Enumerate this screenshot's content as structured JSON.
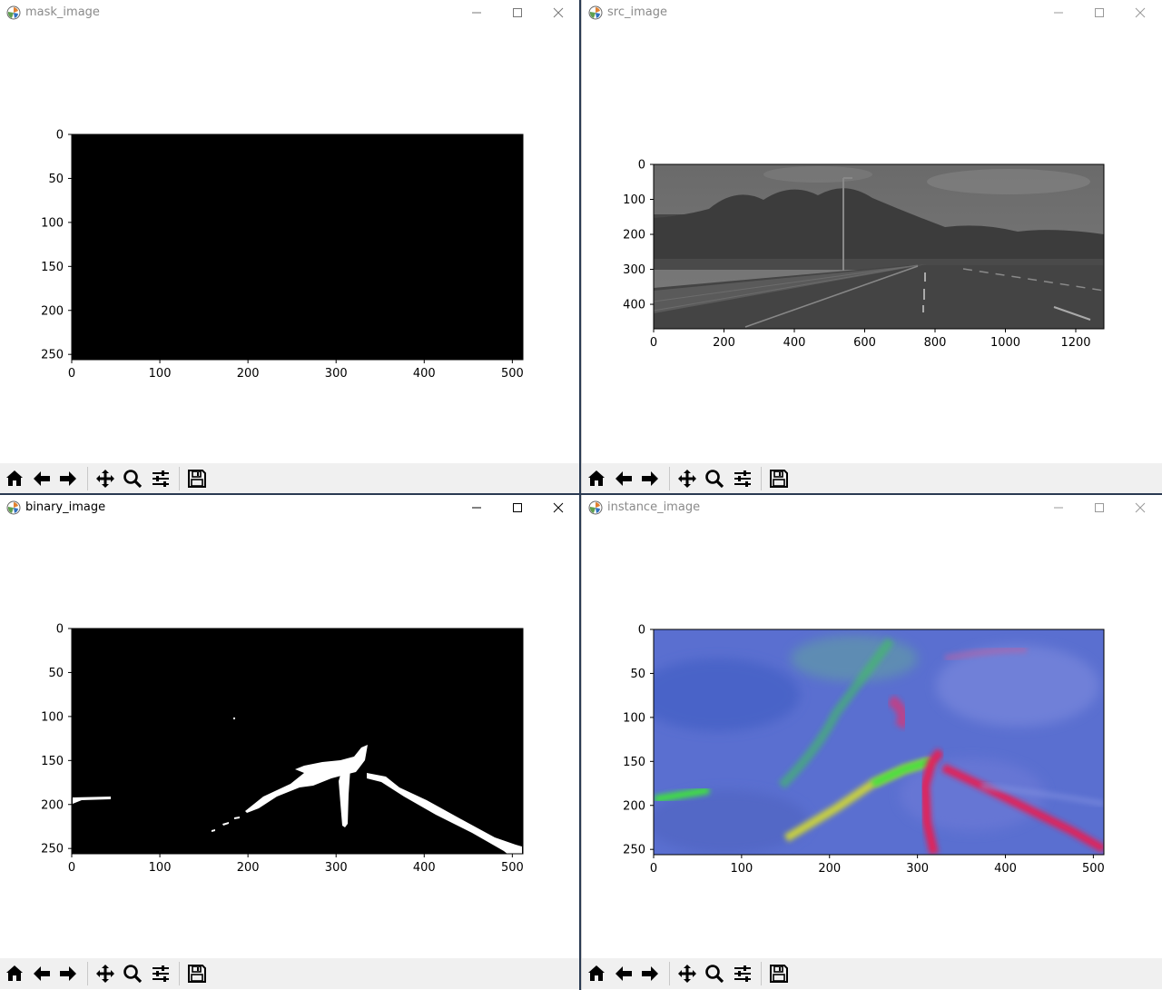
{
  "windows": {
    "mask": {
      "title": "mask_image",
      "chart": {
        "type": "image",
        "title": "",
        "xlim": [
          0,
          512
        ],
        "ylim": [
          256,
          0
        ],
        "xticks": [
          "0",
          "100",
          "200",
          "300",
          "400",
          "500"
        ],
        "yticks": [
          "0",
          "50",
          "100",
          "150",
          "200",
          "250"
        ],
        "content": "all black"
      }
    },
    "src": {
      "title": "src_image",
      "chart": {
        "type": "image",
        "title": "",
        "xlim": [
          0,
          1280
        ],
        "ylim": [
          470,
          0
        ],
        "xticks": [
          "0",
          "200",
          "400",
          "600",
          "800",
          "1000",
          "1200"
        ],
        "yticks": [
          "0",
          "100",
          "200",
          "300",
          "400"
        ],
        "content": "grayscale road scene with trees, buildings, lane markings"
      }
    },
    "binary": {
      "title": "binary_image",
      "chart": {
        "type": "image",
        "title": "",
        "xlim": [
          0,
          512
        ],
        "ylim": [
          256,
          0
        ],
        "xticks": [
          "0",
          "100",
          "200",
          "300",
          "400",
          "500"
        ],
        "yticks": [
          "0",
          "50",
          "100",
          "150",
          "200",
          "250"
        ],
        "content": "white lane segmentation on black"
      }
    },
    "instance": {
      "title": "instance_image",
      "chart": {
        "type": "image",
        "title": "",
        "xlim": [
          0,
          512
        ],
        "ylim": [
          256,
          0
        ],
        "xticks": [
          "0",
          "100",
          "200",
          "300",
          "400",
          "500"
        ],
        "yticks": [
          "0",
          "50",
          "100",
          "150",
          "200",
          "250"
        ],
        "content": "blue instance embedding with green, yellow and red lane strokes"
      }
    }
  },
  "toolbar_icons": [
    "home-icon",
    "back-arrow-icon",
    "forward-arrow-icon",
    "pan-icon",
    "zoom-icon",
    "configure-subplots-icon",
    "save-icon"
  ],
  "colors": {
    "toolbar_bg": "#f0f0f0",
    "desktop": "#2a3a52",
    "instance_bg": "#5a6fd0",
    "lane_red": "#e0205a",
    "lane_green": "#40e040",
    "lane_yellow": "#c8d040"
  }
}
